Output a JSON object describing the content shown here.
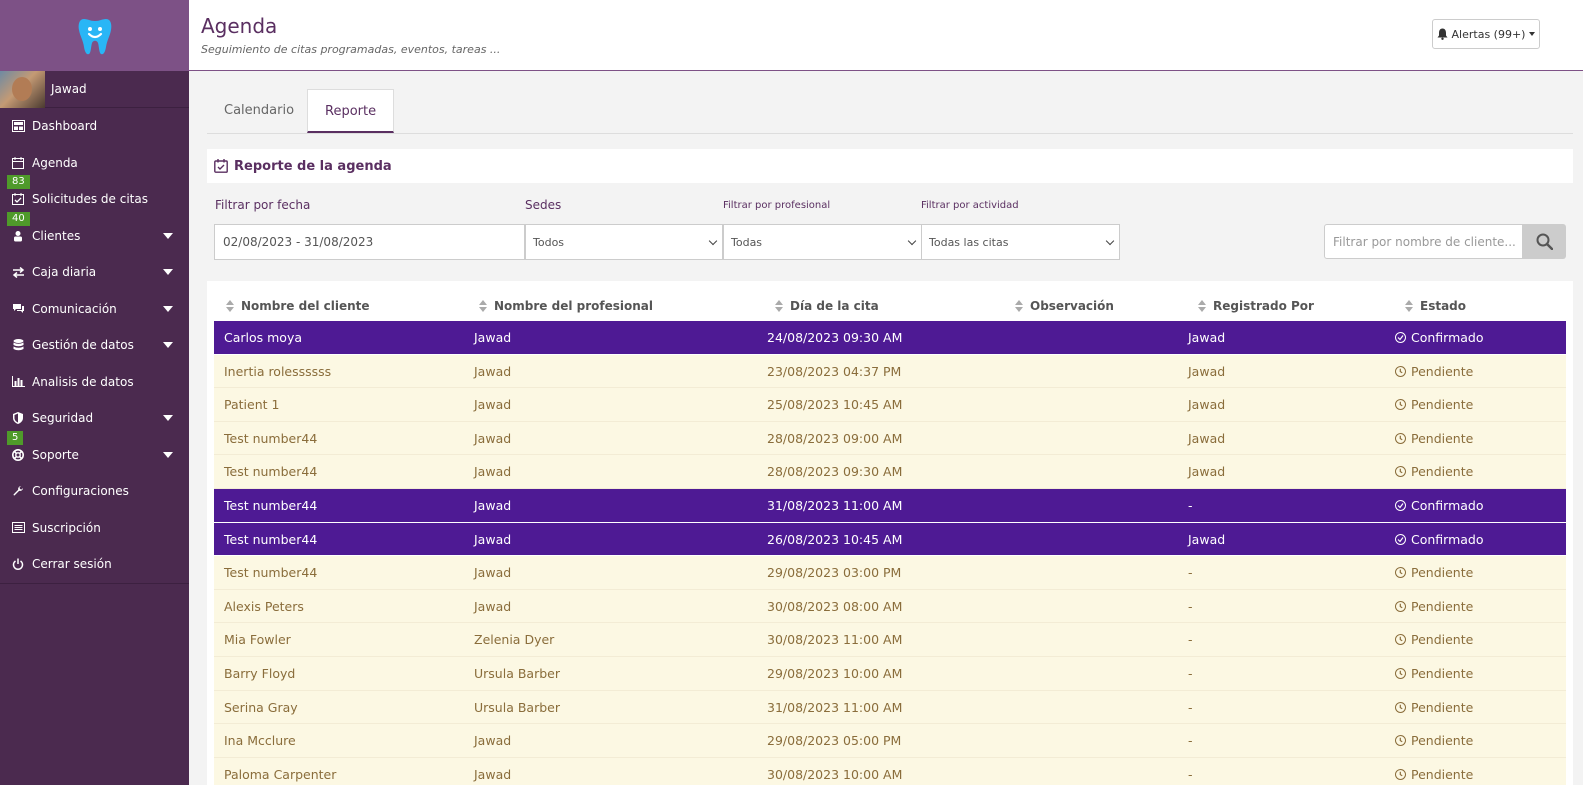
{
  "sidebar": {
    "user_name": "Jawad",
    "items": [
      {
        "label": "Dashboard",
        "icon": "dashboard-icon"
      },
      {
        "label": "Agenda",
        "icon": "calendar-icon",
        "badge": "83"
      },
      {
        "label": "Solicitudes de citas",
        "icon": "calendar-check-icon",
        "badge": "40"
      },
      {
        "label": "Clientes",
        "icon": "users-icon"
      },
      {
        "label": "Caja diaria",
        "icon": "exchange-icon"
      },
      {
        "label": "Comunicación",
        "icon": "chat-icon"
      },
      {
        "label": "Gestión de datos",
        "icon": "database-icon"
      },
      {
        "label": "Analisis de datos",
        "icon": "bar-chart-icon"
      },
      {
        "label": "Seguridad",
        "icon": "shield-icon",
        "badge": "5"
      },
      {
        "label": "Soporte",
        "icon": "lifebuoy-icon"
      },
      {
        "label": "Configuraciones",
        "icon": "wrench-icon"
      },
      {
        "label": "Suscripción",
        "icon": "list-icon"
      },
      {
        "label": "Cerrar sesión",
        "icon": "power-icon"
      }
    ]
  },
  "header": {
    "title": "Agenda",
    "subtitle": "Seguimiento de citas programadas, eventos, tareas ...",
    "alerts_label": "Alertas (99+)"
  },
  "tabs": [
    {
      "label": "Calendario",
      "active": false
    },
    {
      "label": "Reporte",
      "active": true
    }
  ],
  "panel": {
    "title": "Reporte de la agenda"
  },
  "filters": {
    "date_label": "Filtrar por fecha",
    "date_value": "02/08/2023 - 31/08/2023",
    "sedes_label": "Sedes",
    "sedes_value": "Todos",
    "profesional_label": "Filtrar por profesional",
    "profesional_value": "Todas",
    "actividad_label": "Filtrar por actividad",
    "actividad_value": "Todas las citas",
    "search_placeholder": "Filtrar por nombre de cliente..."
  },
  "table": {
    "columns": [
      "Nombre del cliente",
      "Nombre del profesional",
      "Día de la cita",
      "Observación",
      "Registrado Por",
      "Estado"
    ],
    "rows": [
      {
        "cliente": "Carlos moya",
        "profesional": "Jawad",
        "dia": "24/08/2023 09:30 AM",
        "observacion": "",
        "registrado": "Jawad",
        "estado": "Confirmado"
      },
      {
        "cliente": "Inertia rolessssss",
        "profesional": "Jawad",
        "dia": "23/08/2023 04:37 PM",
        "observacion": "",
        "registrado": "Jawad",
        "estado": "Pendiente"
      },
      {
        "cliente": "Patient 1",
        "profesional": "Jawad",
        "dia": "25/08/2023 10:45 AM",
        "observacion": "",
        "registrado": "Jawad",
        "estado": "Pendiente"
      },
      {
        "cliente": "Test number44",
        "profesional": "Jawad",
        "dia": "28/08/2023 09:00 AM",
        "observacion": "",
        "registrado": "Jawad",
        "estado": "Pendiente"
      },
      {
        "cliente": "Test number44",
        "profesional": "Jawad",
        "dia": "28/08/2023 09:30 AM",
        "observacion": "",
        "registrado": "Jawad",
        "estado": "Pendiente"
      },
      {
        "cliente": "Test number44",
        "profesional": "Jawad",
        "dia": "31/08/2023 11:00 AM",
        "observacion": "",
        "registrado": "-",
        "estado": "Confirmado"
      },
      {
        "cliente": "Test number44",
        "profesional": "Jawad",
        "dia": "26/08/2023 10:45 AM",
        "observacion": "",
        "registrado": "Jawad",
        "estado": "Confirmado"
      },
      {
        "cliente": "Test number44",
        "profesional": "Jawad",
        "dia": "29/08/2023 03:00 PM",
        "observacion": "",
        "registrado": "-",
        "estado": "Pendiente"
      },
      {
        "cliente": "Alexis Peters",
        "profesional": "Jawad",
        "dia": "30/08/2023 08:00 AM",
        "observacion": "",
        "registrado": "-",
        "estado": "Pendiente"
      },
      {
        "cliente": "Mia Fowler",
        "profesional": "Zelenia Dyer",
        "dia": "30/08/2023 11:00 AM",
        "observacion": "",
        "registrado": "-",
        "estado": "Pendiente"
      },
      {
        "cliente": "Barry Floyd",
        "profesional": "Ursula Barber",
        "dia": "29/08/2023 10:00 AM",
        "observacion": "",
        "registrado": "-",
        "estado": "Pendiente"
      },
      {
        "cliente": "Serina Gray",
        "profesional": "Ursula Barber",
        "dia": "31/08/2023 11:00 AM",
        "observacion": "",
        "registrado": "-",
        "estado": "Pendiente"
      },
      {
        "cliente": "Ina Mcclure",
        "profesional": "Jawad",
        "dia": "29/08/2023 05:00 PM",
        "observacion": "",
        "registrado": "-",
        "estado": "Pendiente"
      },
      {
        "cliente": "Paloma Carpenter",
        "profesional": "Jawad",
        "dia": "30/08/2023 10:00 AM",
        "observacion": "",
        "registrado": "-",
        "estado": "Pendiente"
      }
    ]
  },
  "colors": {
    "sidebar_bg": "#4b2a4f",
    "logo_bg": "#7d5186",
    "accent": "#5a2f61",
    "confirmed_row": "#4e1a94",
    "pending_row": "#fcf8e3",
    "pending_text": "#8a6d3b",
    "badge_green": "#4f9a2a",
    "logo_tooth": "#29b6f6"
  }
}
